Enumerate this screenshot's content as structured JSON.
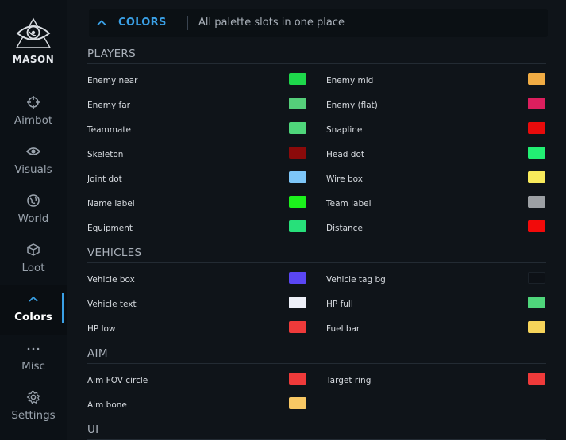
{
  "app": {
    "logo_text": "MASON"
  },
  "sidebar": {
    "items": [
      {
        "label": "Aimbot"
      },
      {
        "label": "Visuals"
      },
      {
        "label": "World"
      },
      {
        "label": "Loot"
      },
      {
        "label": "Colors"
      },
      {
        "label": "Misc"
      },
      {
        "label": "Settings"
      }
    ]
  },
  "header": {
    "title": "COLORS",
    "subtitle": "All palette slots in one place"
  },
  "colors": {
    "accent": "#3aa0e6",
    "sections": [
      {
        "title": "PLAYERS",
        "rows": [
          [
            {
              "label": "Enemy near",
              "color": "#1ed84b"
            },
            {
              "label": "Enemy mid",
              "color": "#f0ac44"
            }
          ],
          [
            {
              "label": "Enemy far",
              "color": "#55cf7a"
            },
            {
              "label": "Enemy (flat)",
              "color": "#dc1f5e"
            }
          ],
          [
            {
              "label": "Teammate",
              "color": "#4fd67b"
            },
            {
              "label": "Snapline",
              "color": "#e80b0b"
            }
          ],
          [
            {
              "label": "Skeleton",
              "color": "#8b0a0a"
            },
            {
              "label": "Head dot",
              "color": "#22ef73"
            }
          ],
          [
            {
              "label": "Joint dot",
              "color": "#7dc6f8"
            },
            {
              "label": "Wire box",
              "color": "#f8ea5b"
            }
          ],
          [
            {
              "label": "Name label",
              "color": "#1cf11c"
            },
            {
              "label": "Team label",
              "color": "#9ca0a4"
            }
          ],
          [
            {
              "label": "Equipment",
              "color": "#27e07a"
            },
            {
              "label": "Distance",
              "color": "#f20a0a"
            }
          ]
        ]
      },
      {
        "title": "VEHICLES",
        "rows": [
          [
            {
              "label": "Vehicle box",
              "color": "#5a46f4"
            },
            {
              "label": "Vehicle tag bg",
              "color": "#0d1116"
            }
          ],
          [
            {
              "label": "Vehicle text",
              "color": "#eef0f8"
            },
            {
              "label": "HP full",
              "color": "#4fd67b"
            }
          ],
          [
            {
              "label": "HP low",
              "color": "#ef3a3a"
            },
            {
              "label": "Fuel bar",
              "color": "#f6d45a"
            }
          ]
        ]
      },
      {
        "title": "AIM",
        "rows": [
          [
            {
              "label": "Aim FOV circle",
              "color": "#ef3a3a"
            },
            {
              "label": "Target ring",
              "color": "#ef3a3a"
            }
          ],
          [
            {
              "label": "Aim bone",
              "color": "#f8c864"
            }
          ]
        ]
      },
      {
        "title": "UI",
        "rows": []
      }
    ]
  }
}
